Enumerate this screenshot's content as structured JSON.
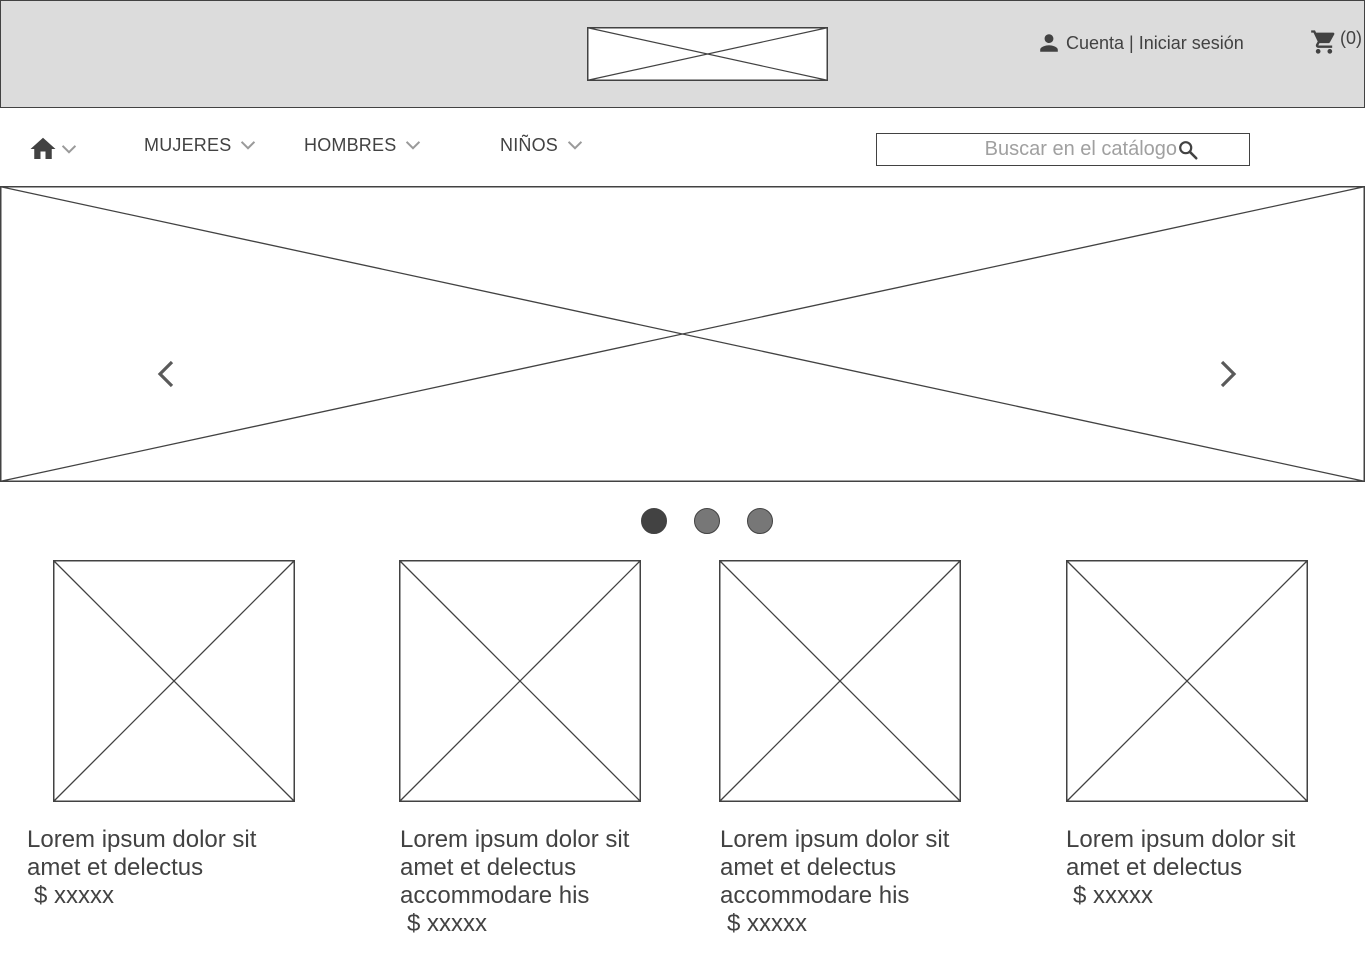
{
  "header": {
    "account_label": "Cuenta | Iniciar sesión",
    "cart_count": "(0)"
  },
  "nav": {
    "items": [
      {
        "label": "MUJERES"
      },
      {
        "label": "HOMBRES"
      },
      {
        "label": "NIÑOS"
      }
    ],
    "search_placeholder": "Buscar en el catálogo"
  },
  "carousel": {
    "slides": 3,
    "active_slide": 1
  },
  "products": [
    {
      "description": "Lorem ipsum dolor sit amet et delectus",
      "price": "$ xxxxx"
    },
    {
      "description": "Lorem ipsum dolor sit amet et delectus accommodare his",
      "price": "$ xxxxx"
    },
    {
      "description": "Lorem ipsum dolor sit amet et delectus accommodare his",
      "price": "$ xxxxx"
    },
    {
      "description": "Lorem ipsum dolor sit amet et delectus",
      "price": "$ xxxxx"
    }
  ],
  "colors": {
    "header_bg": "#dcdcdc",
    "stroke": "#424242",
    "dot_inactive": "#777777",
    "placeholder": "#a0a0a0"
  }
}
